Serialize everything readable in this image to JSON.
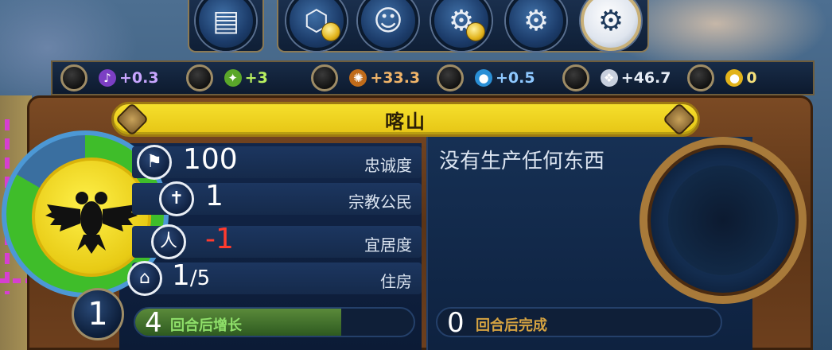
{
  "lens_buttons": [
    {
      "icon": "builder-icon",
      "glyph": "▤",
      "has_coin": false,
      "active": false
    },
    {
      "icon": "district-icon",
      "glyph": "⬡",
      "has_coin": true,
      "active": false
    },
    {
      "icon": "great-person-icon",
      "glyph": "☺",
      "has_coin": false,
      "active": false
    },
    {
      "icon": "production-gear-icon",
      "glyph": "⚙",
      "has_coin": true,
      "active": false
    },
    {
      "icon": "faith-gear-icon",
      "glyph": "⚙",
      "has_coin": false,
      "active": false
    },
    {
      "icon": "settings-gear-icon",
      "glyph": "⚙",
      "has_coin": false,
      "active": true
    }
  ],
  "yields": [
    {
      "name": "culture",
      "icon": "culture-icon",
      "glyph": "♪",
      "icon_bg": "#7c3fc4",
      "value": "+0.3",
      "color": "#c9a6ff"
    },
    {
      "name": "food",
      "icon": "food-icon",
      "glyph": "✦",
      "icon_bg": "#5aa72a",
      "value": "+3",
      "color": "#b8f060"
    },
    {
      "name": "production",
      "icon": "production-icon",
      "glyph": "✺",
      "icon_bg": "#c06b1a",
      "value": "+33.3",
      "color": "#f0b469"
    },
    {
      "name": "science",
      "icon": "science-icon",
      "glyph": "●",
      "icon_bg": "#2a8fd6",
      "value": "+0.5",
      "color": "#8ec8ff"
    },
    {
      "name": "faith",
      "icon": "faith-icon",
      "glyph": "❖",
      "icon_bg": "#c8d0de",
      "value": "+46.7",
      "color": "#e6ecf5"
    },
    {
      "name": "gold",
      "icon": "gold-icon",
      "glyph": "●",
      "icon_bg": "#e2b31a",
      "value": "0",
      "color": "#f5e07a"
    }
  ],
  "city": {
    "name": "喀山"
  },
  "stats": [
    {
      "icon": "loyalty-flag-icon",
      "glyph": "⚑",
      "value": "100",
      "value_color": "#ffffff",
      "label": "忠诚度"
    },
    {
      "icon": "religion-cross-icon",
      "glyph": "✝",
      "value": "1",
      "value_color": "#ffffff",
      "label": "宗教公民"
    },
    {
      "icon": "amenities-icon",
      "glyph": "人",
      "value": "-1",
      "value_color": "#ff3b2e",
      "label": "宜居度"
    },
    {
      "icon": "housing-icon",
      "glyph": "⌂",
      "value": "1",
      "value_suffix": "/5",
      "value_color": "#ffffff",
      "label": "住房"
    }
  ],
  "population": {
    "value": "1"
  },
  "growth": {
    "turns": "4",
    "label": "回合后增长",
    "progress": 0.74
  },
  "production": {
    "status": "没有生产任何东西",
    "turns": "0",
    "label": "回合后完成"
  },
  "colors": {
    "accent_yellow": "#f5df2c",
    "panel_blue": "#12264a",
    "wood": "#6d3f1d"
  }
}
